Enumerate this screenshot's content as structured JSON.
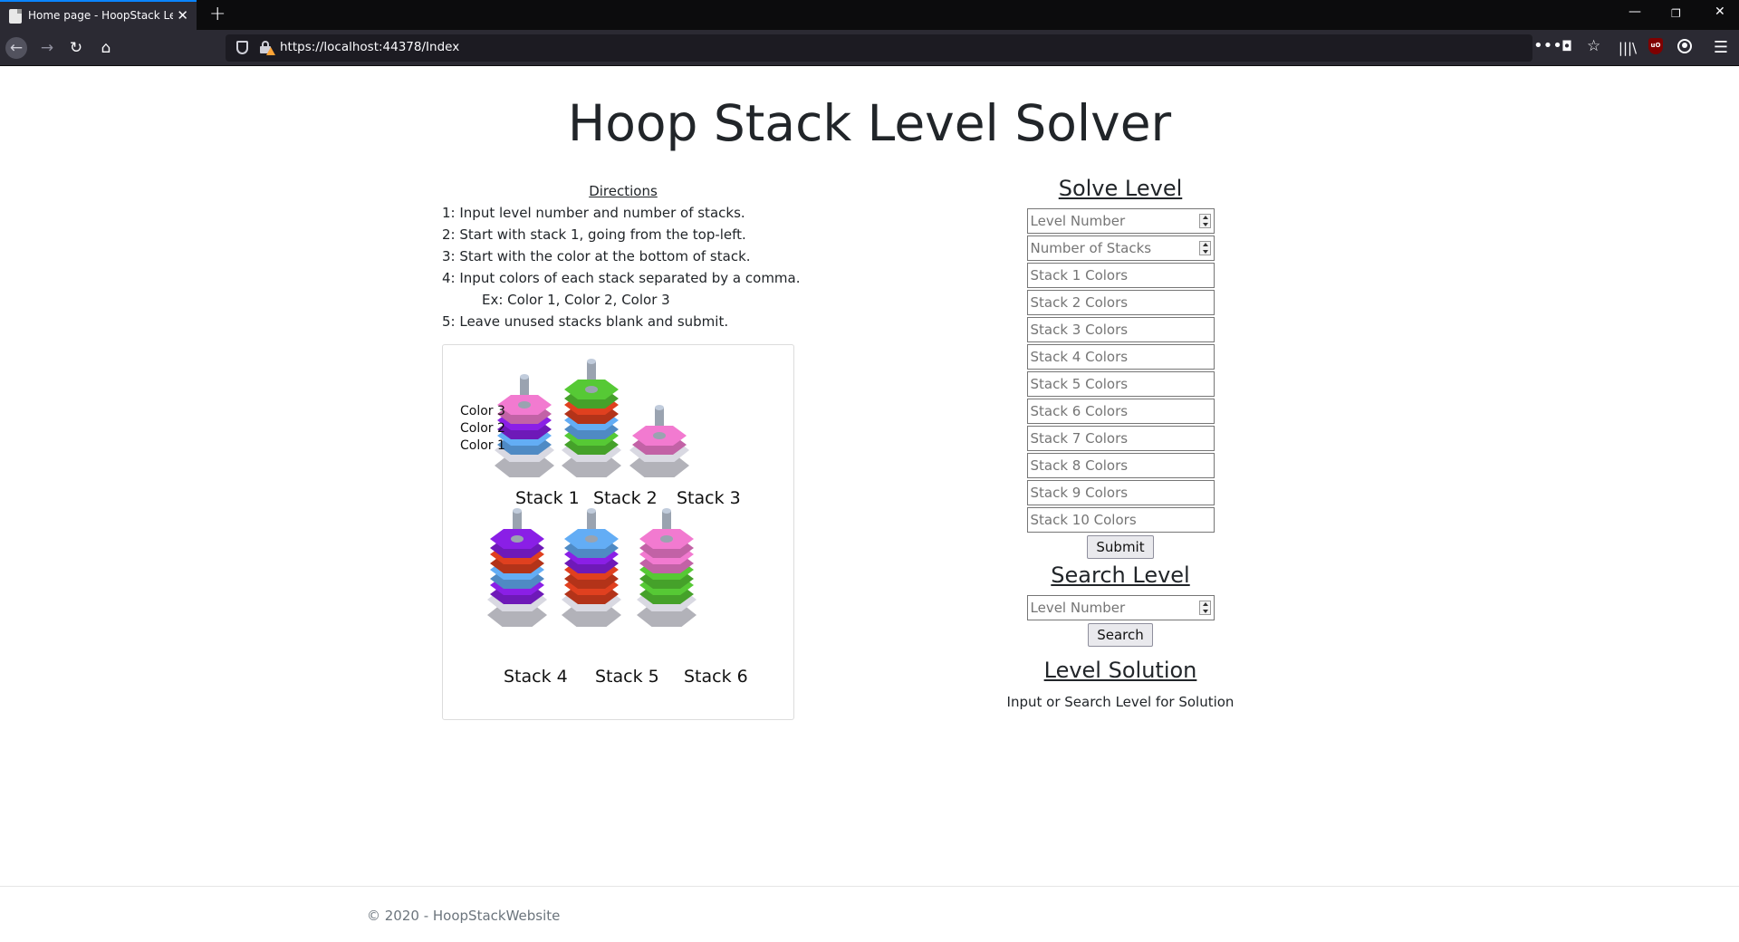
{
  "browser": {
    "tab_title": "Home page - HoopStack Level",
    "url": "https://localhost:44378/Index"
  },
  "page": {
    "title": "Hoop Stack Level Solver"
  },
  "directions": {
    "heading": "Directions",
    "steps": [
      "1: Input level number and number of stacks.",
      "2: Start with stack 1, going from the top-left.",
      "3: Start with the color at the bottom of stack.",
      "4: Input colors of each stack separated by a comma.",
      "Ex: Color 1, Color 2, Color 3",
      "5: Leave unused stacks blank and submit."
    ]
  },
  "example_image": {
    "color_labels": [
      "Color 3",
      "Color 2",
      "Color 1"
    ],
    "stack_labels": [
      "Stack 1",
      "Stack 2",
      "Stack 3",
      "Stack 4",
      "Stack 5",
      "Stack 6"
    ],
    "colors": {
      "pink": "#f27ad0",
      "purple": "#8a1fe6",
      "blue": "#63adf5",
      "green": "#56c935",
      "red": "#e0401f",
      "base": "#d9d9e2",
      "peg": "#9aa3b0"
    }
  },
  "solve_level": {
    "heading": "Solve Level",
    "level_placeholder": "Level Number",
    "stacks_count_placeholder": "Number of Stacks",
    "stack_placeholders": [
      "Stack 1 Colors",
      "Stack 2 Colors",
      "Stack 3 Colors",
      "Stack 4 Colors",
      "Stack 5 Colors",
      "Stack 6 Colors",
      "Stack 7 Colors",
      "Stack 8 Colors",
      "Stack 9 Colors",
      "Stack 10 Colors"
    ],
    "submit_label": "Submit"
  },
  "search_level": {
    "heading": "Search Level",
    "level_placeholder": "Level Number",
    "search_label": "Search"
  },
  "level_solution": {
    "heading": "Level Solution",
    "text": "Input or Search Level for Solution"
  },
  "footer": {
    "text": "© 2020 - HoopStackWebsite"
  }
}
